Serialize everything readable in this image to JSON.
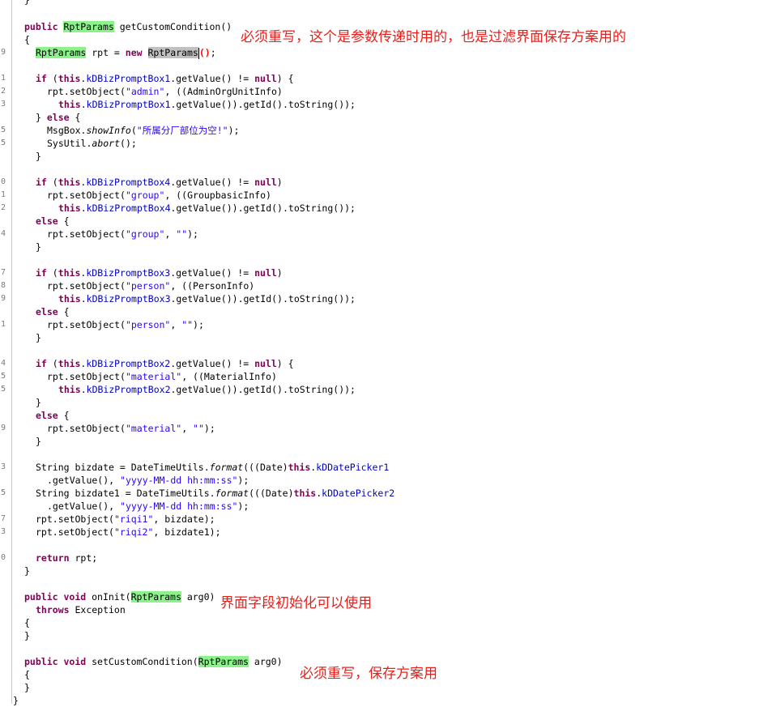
{
  "annotations": {
    "note1": "必须重写，这个是参数传递时用的，也是过滤界面保存方案用的",
    "note2": "界面字段初始化可以使用",
    "note3": "必须重写，保存方案用"
  },
  "gutter": [
    "9",
    "1",
    "2",
    "3",
    "5",
    "5",
    "0",
    "1",
    "2",
    "4",
    "7",
    "8",
    "9",
    "1",
    "4",
    "5",
    "5",
    "9",
    "3",
    "5",
    "7",
    "3",
    "0"
  ],
  "code": {
    "m1_sig_kw": "public",
    "m1_sig_type": "RptParams",
    "m1_sig_rest": " getCustomCondition()",
    "open_brace": "{",
    "close_brace": "}",
    "rpt_type": "RptParams",
    "rpt_decl": " rpt = ",
    "kw_new": "new",
    "rpt_new_type": "RptParams",
    "paren_open": "(",
    "paren_close": ")",
    "semi": ";",
    "kw_if": "if",
    "kw_this": "this",
    "kw_null": "null",
    "kw_else": "else",
    "kw_return": "return",
    "box1": "kDBizPromptBox1",
    "box2": "kDBizPromptBox2",
    "box3": "kDBizPromptBox3",
    "box4": "kDBizPromptBox4",
    "cond_mid": ".getValue() != ",
    "cond_end_brace": ") {",
    "cond_end": ")",
    "set_obj": "rpt.setObject(",
    "str_admin": "\"admin\"",
    "str_group": "\"group\"",
    "str_person": "\"person\"",
    "str_material": "\"material\"",
    "str_empty": "\"\"",
    "str_riqi1": "\"riqi1\"",
    "str_riqi2": "\"riqi2\"",
    "str_fmt": "\"yyyy-MM-dd hh:mm:ss\"",
    "cast_admin": ", ((AdminOrgUnitInfo)",
    "cast_group": ", ((GroupbasicInfo)",
    "cast_person": ", ((PersonInfo)",
    "cast_material": ", ((MaterialInfo)",
    "getid_tail": ".getValue()).getId().toString());",
    "empty_tail": ", ",
    "end_call": ");",
    "else_open": "} else {",
    "else_line": " {",
    "msgbox": "MsgBox.",
    "showinfo": "showInfo",
    "str_msg": "\"所属分厂部位为空!\"",
    "sysutil": "SysUtil.",
    "abort": "abort",
    "abort_tail": "();",
    "bizdate_a": "String bizdate = DateTimeUtils.",
    "bizdate1_a": "String bizdate1 = DateTimeUtils.",
    "format": "format",
    "cast_date": "((Date)",
    "picker1": "kDDatePicker1",
    "picker2": "kDDatePicker2",
    "getvalue_line": ".getValue(), ",
    "set_riqi1_tail": ", bizdate);",
    "set_riqi2_tail": ", bizdate1);",
    "return_tail": " rpt;",
    "kw_public": "public",
    "kw_void": "void",
    "oninit": " onInit(",
    "arg0_close": " arg0)",
    "kw_throws": "throws",
    "exception": " Exception",
    "setcustom": " setCustomCondition(",
    "top_brace": "}"
  }
}
